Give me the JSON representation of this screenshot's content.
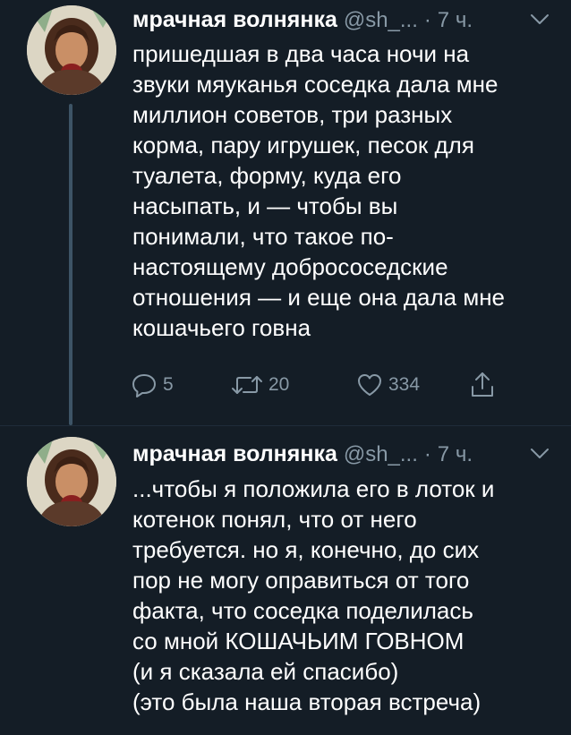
{
  "tweets": [
    {
      "author_name": "мрачная волнянка",
      "handle": "@sh_...",
      "separator": "·",
      "time": "7 ч.",
      "text": "пришедшая в два часа ночи на\nзвуки мяуканья соседка дала мне\nмиллион советов, три разных\nкорма, пару игрушек, песок для\nтуалета, форму, куда его\nнасыпать, и — чтобы вы\nпонимали, что такое по-\nнастоящему добрососедские\nотношения — и еще она дала мне\nкошачьего говна",
      "reply_count": "5",
      "retweet_count": "20",
      "like_count": "334"
    },
    {
      "author_name": "мрачная волнянка",
      "handle": "@sh_...",
      "separator": "·",
      "time": "7 ч.",
      "text": "...чтобы я положила его в лоток и\nкотенок понял, что от него\nтребуется. но я, конечно, до сих\nпор не могу оправиться от того\nфакта, что соседка поделилась\nсо мной КОШАЧЬИМ ГОВНОМ\n(и я сказала ей спасибо)\n(это была наша вторая встреча)"
    }
  ],
  "icons": {
    "reply": "reply-icon",
    "retweet": "retweet-icon",
    "like": "heart-icon",
    "share": "share-icon",
    "more": "chevron-down-icon"
  },
  "colors": {
    "background": "#141d26",
    "text": "#ffffff",
    "secondary": "#8899a6",
    "thread_line": "#3d5466"
  }
}
